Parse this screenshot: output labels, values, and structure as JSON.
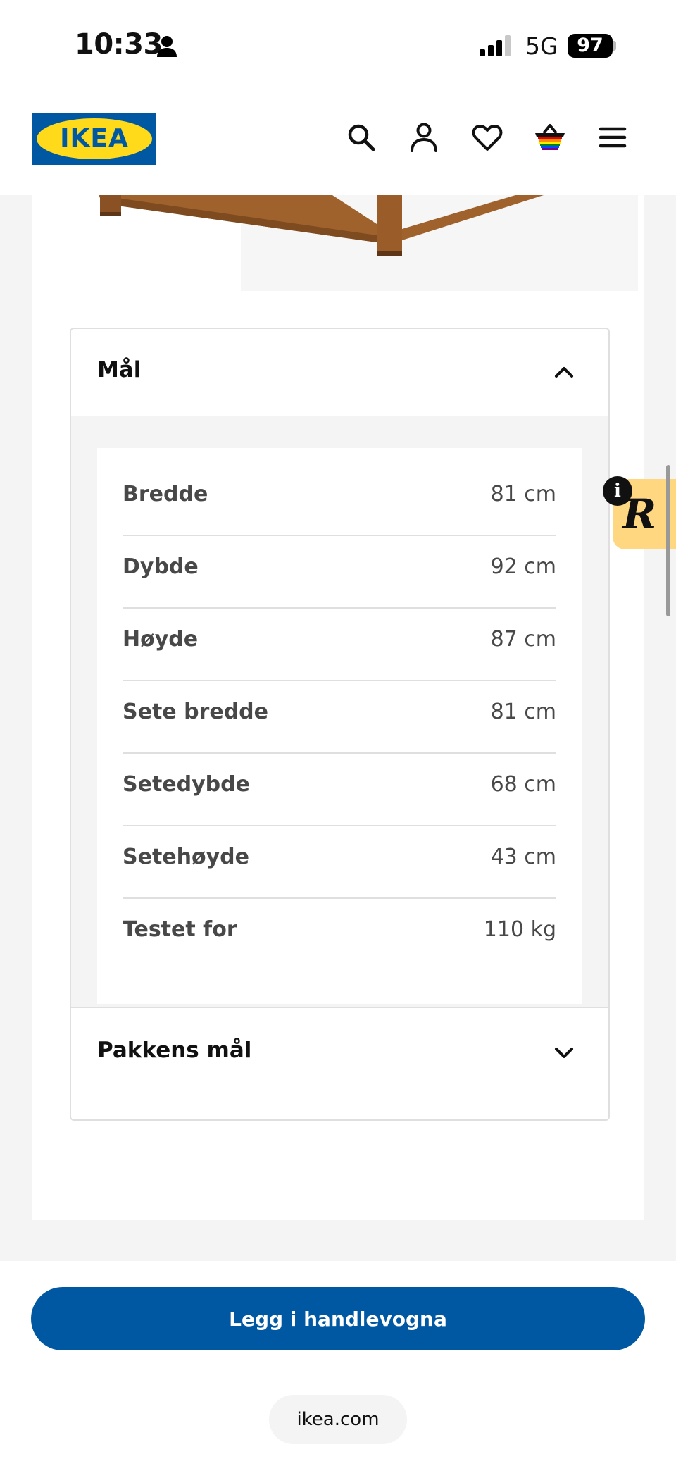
{
  "status_bar": {
    "time": "10:33",
    "network": "5G",
    "battery": "97"
  },
  "header": {
    "logo_text": "IKEA",
    "icons": [
      "search-icon",
      "profile-icon",
      "heart-icon",
      "basket-icon",
      "menu-icon"
    ]
  },
  "dimensions_section": {
    "title": "Mål",
    "rows": [
      {
        "label": "Bredde",
        "value": "81 cm"
      },
      {
        "label": "Dybde",
        "value": "92 cm"
      },
      {
        "label": "Høyde",
        "value": "87 cm"
      },
      {
        "label": "Sete bredde",
        "value": "81 cm"
      },
      {
        "label": "Setedybde",
        "value": "68 cm"
      },
      {
        "label": "Setehøyde",
        "value": "43 cm"
      },
      {
        "label": "Testet for",
        "value": "110 kg"
      }
    ]
  },
  "package_section": {
    "title": "Pakkens mål"
  },
  "cta": {
    "label": "Legg i handlevogna"
  },
  "browser": {
    "url": "ikea.com"
  },
  "side_badge": {
    "info_glyph": "i",
    "badge_letter": "R"
  },
  "colors": {
    "brand_blue": "#0058a3",
    "brand_yellow": "#ffda1a",
    "badge_yellow": "#ffd780"
  }
}
